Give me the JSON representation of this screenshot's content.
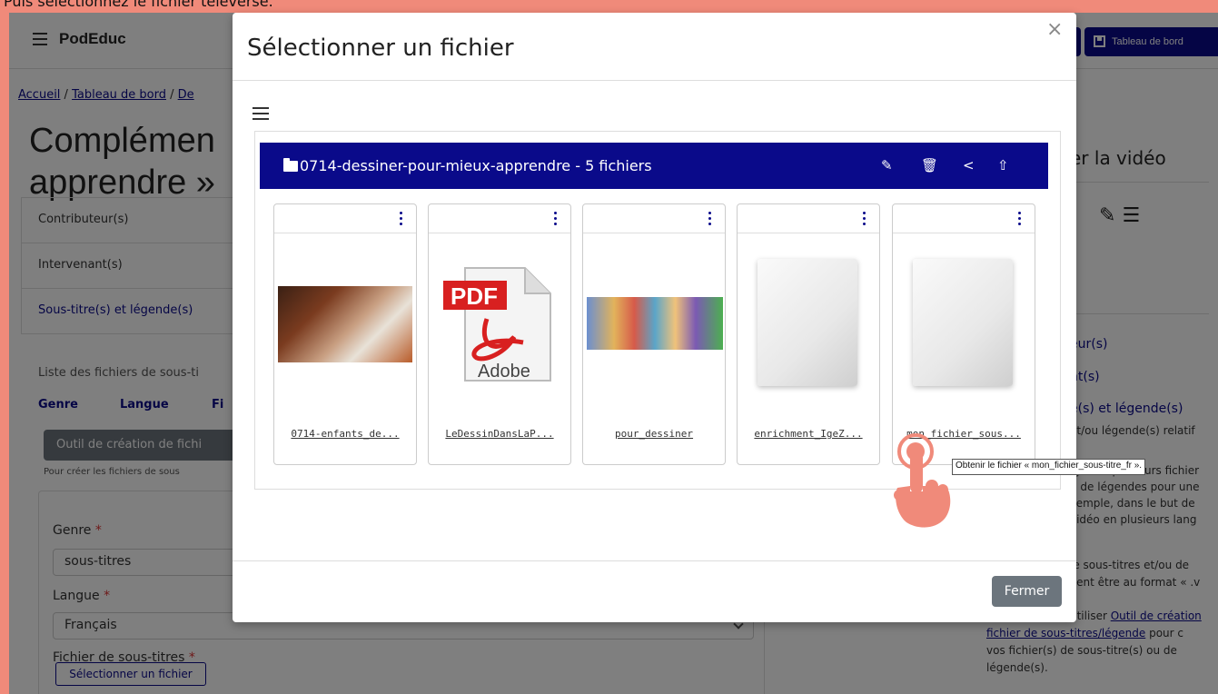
{
  "caption": "Puis sélectionnez le fichier téléversé.",
  "navbar": {
    "brand": "PodEduc",
    "dashboard_label": "Tableau de bord"
  },
  "breadcrumb": [
    "Accueil",
    "Tableau de bord",
    "De"
  ],
  "page": {
    "title_line1": "Complémen",
    "title_line2": "apprendre »"
  },
  "accordion": [
    "Contributeur(s)",
    "Intervenant(s)",
    "Sous-titre(s) et légende(s)"
  ],
  "subtitles_section": {
    "list_text": "Liste des fichiers de sous-ti",
    "col_genre": "Genre",
    "col_langue": "Langue",
    "col_fichier": "Fi",
    "tool_button": "Outil de création de fichi",
    "tool_help": "Pour créer les fichiers de sous",
    "genre_label": "Genre",
    "genre_value": "sous-titres",
    "langue_label": "Langue",
    "langue_value": "Français",
    "fichier_label": "Fichier de sous-titres",
    "select_file_button": "Sélectionner un fichier",
    "required_mark": "*"
  },
  "right_panel": {
    "title": "er la vidéo",
    "links": [
      "eur(s)",
      "nt(s)",
      "e(s) et légende(s)"
    ],
    "text_lines": [
      "et/ou légende(s) relatif",
      "ajouter plusieurs fichier",
      "u de légendes pour une",
      "xemple, dans le but de",
      "vidéo en plusieurs lang",
      "le sous-titres et/ou de",
      "vent être au format « .v"
    ],
    "tool_prefix": "utiliser",
    "tool_link": "Outil de création",
    "tool_link2": "fichier de sous-titres/légende",
    "tool_suffix": "pour c",
    "tool_line3": "vos fichier(s) de sous-titre(s) ou de",
    "tool_line4": "légende(s)."
  },
  "modal": {
    "title": "Sélectionner un fichier",
    "close_symbol": "×",
    "folder_name": "0714-dessiner-pour-mieux-apprendre - 5 fichiers",
    "files": [
      {
        "name": "0714-enfants_de...",
        "thumb": "photo-children-drawing"
      },
      {
        "name": "LeDessinDansLaP...",
        "thumb": "pdf-icon"
      },
      {
        "name": "pour_dessiner",
        "thumb": "photo-colorful-classroom"
      },
      {
        "name": "enrichment_IgeZ...",
        "thumb": "blank-document"
      },
      {
        "name": "mon_fichier_sous...",
        "thumb": "blank-document"
      }
    ],
    "close_button": "Fermer",
    "tooltip": "Obtenir le fichier « mon_fichier_sous-titre_fr »."
  },
  "colors": {
    "border_accent": "#f08a7a",
    "primary": "#0a0a8a",
    "secondary_button": "#6c757d",
    "hand_icon": "#f08a7a"
  }
}
